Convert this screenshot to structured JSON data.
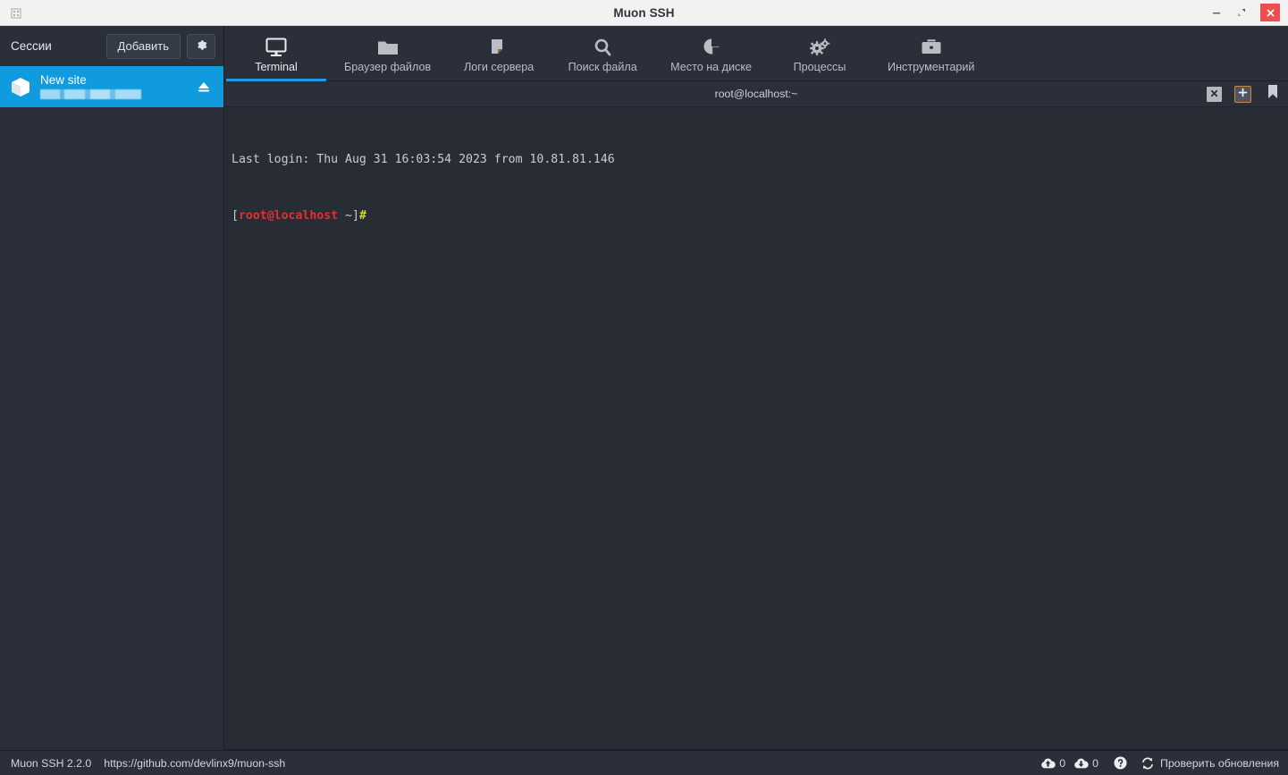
{
  "window": {
    "title": "Muon SSH",
    "app_icon": "app-icon",
    "controls": [
      {
        "name": "minimize-button",
        "glyph": "minimize-icon"
      },
      {
        "name": "restore-button",
        "glyph": "restore-icon"
      },
      {
        "name": "close-button",
        "glyph": "close-icon"
      }
    ],
    "accent_color": "#1e9ce8",
    "close_color": "#ef4e4e",
    "titlebar_bg": "#f2f2f2"
  },
  "sidebar": {
    "title": "Сессии",
    "add_button": "Добавить",
    "settings_button_icon": "gear-icon",
    "sessions": [
      {
        "name": "New site",
        "subtitle": "",
        "icon": "cube-icon",
        "eject_icon": "eject-icon",
        "selected": true
      }
    ],
    "selected_color": "#109bdf",
    "background": "#2b2f3a"
  },
  "toolbar": {
    "tabs": [
      {
        "label": "Terminal",
        "icon": "monitor-icon",
        "active": true
      },
      {
        "label": "Браузер файлов",
        "icon": "folder-icon",
        "active": false
      },
      {
        "label": "Логи сервера",
        "icon": "document-icon",
        "active": false
      },
      {
        "label": "Поиск файла",
        "icon": "search-icon",
        "active": false
      },
      {
        "label": "Место на диске",
        "icon": "pie-chart-icon",
        "active": false
      },
      {
        "label": "Процессы",
        "icon": "gears-icon",
        "active": false
      },
      {
        "label": "Инструментарий",
        "icon": "briefcase-icon",
        "active": false
      }
    ]
  },
  "terminal_tabbar": {
    "title": "root@localhost:~",
    "actions": [
      {
        "name": "close-tab-button",
        "icon": "close-icon"
      },
      {
        "name": "new-tab-button",
        "icon": "plus-icon"
      },
      {
        "name": "bookmark-button",
        "icon": "bookmark-icon"
      }
    ]
  },
  "terminal": {
    "background": "#282c35",
    "lines": [
      {
        "text": "Last login: Thu Aug 31 16:03:54 2023 from 10.81.81.146"
      }
    ],
    "prompt": {
      "bracket_open": "[",
      "user_host": "root@localhost",
      "path": " ~]",
      "symbol": "#"
    },
    "prompt_user_color": "#e03030",
    "prompt_symbol_color": "#d6d62b"
  },
  "statusbar": {
    "version": "Muon SSH 2.2.0",
    "url": "https://github.com/devlinx9/muon-ssh",
    "upload": {
      "icon": "cloud-upload-icon",
      "count": "0"
    },
    "download": {
      "icon": "cloud-download-icon",
      "count": "0"
    },
    "help_icon": "help-circle-icon",
    "update_icon": "refresh-icon",
    "update_label": "Проверить обновления"
  }
}
